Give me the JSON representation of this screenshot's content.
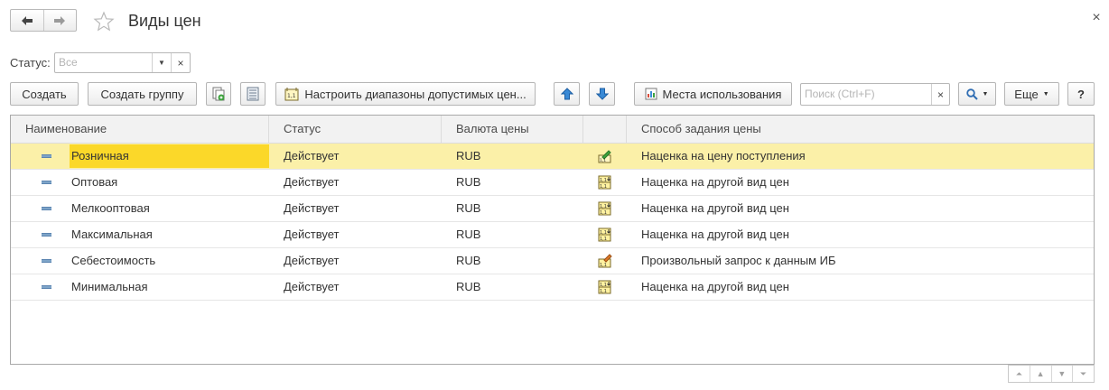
{
  "window": {
    "title": "Виды цен"
  },
  "filter": {
    "status_label": "Статус:",
    "status_placeholder": "Все"
  },
  "toolbar": {
    "create": "Создать",
    "create_group": "Создать группу",
    "configure_ranges": "Настроить диапазоны допустимых цен...",
    "usage_places": "Места использования",
    "search_placeholder": "Поиск (Ctrl+F)",
    "more": "Еще",
    "help": "?"
  },
  "table": {
    "columns": [
      "Наименование",
      "Статус",
      "Валюта цены",
      "",
      "Способ задания цены"
    ],
    "rows": [
      {
        "name": "Розничная",
        "status": "Действует",
        "currency": "RUB",
        "icon": "markup-receipt-icon",
        "method": "Наценка на цену поступления",
        "selected": true
      },
      {
        "name": "Оптовая",
        "status": "Действует",
        "currency": "RUB",
        "icon": "markup-other-icon",
        "method": "Наценка на другой вид цен",
        "selected": false
      },
      {
        "name": "Мелкооптовая",
        "status": "Действует",
        "currency": "RUB",
        "icon": "markup-other-icon",
        "method": "Наценка на другой вид цен",
        "selected": false
      },
      {
        "name": "Максимальная",
        "status": "Действует",
        "currency": "RUB",
        "icon": "markup-other-icon",
        "method": "Наценка на другой вид цен",
        "selected": false
      },
      {
        "name": "Себестоимость",
        "status": "Действует",
        "currency": "RUB",
        "icon": "custom-query-icon",
        "method": "Произвольный запрос к данным ИБ",
        "selected": false
      },
      {
        "name": "Минимальная",
        "status": "Действует",
        "currency": "RUB",
        "icon": "markup-other-icon",
        "method": "Наценка на другой вид цен",
        "selected": false
      }
    ]
  },
  "colors": {
    "selected_row": "#fbf0a8",
    "selected_cell": "#fbd829",
    "accent_blue": "#3a8ad6"
  }
}
